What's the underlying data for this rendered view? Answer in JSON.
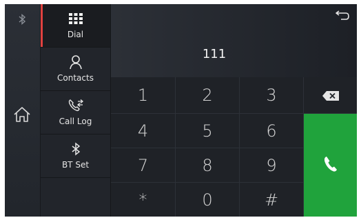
{
  "sidebar": {
    "bluetooth_icon": "bluetooth-icon",
    "home_icon": "home-icon"
  },
  "nav": {
    "items": [
      {
        "label": "Dial",
        "icon": "dialpad-icon"
      },
      {
        "label": "Contacts",
        "icon": "person-icon"
      },
      {
        "label": "Call Log",
        "icon": "call-log-icon"
      },
      {
        "label": "BT Set",
        "icon": "bluetooth-icon"
      }
    ]
  },
  "display": {
    "number": "111"
  },
  "keypad": {
    "rows": [
      [
        "1",
        "2",
        "3"
      ],
      [
        "4",
        "5",
        "6"
      ],
      [
        "7",
        "8",
        "9"
      ],
      [
        "*",
        "0",
        "#"
      ]
    ]
  },
  "colors": {
    "call_green": "#20a33c",
    "active_marker": "#e0413f"
  }
}
